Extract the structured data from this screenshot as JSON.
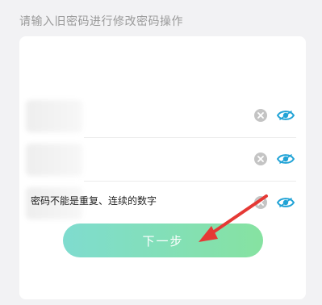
{
  "hint": "请输入旧密码进行修改密码操作",
  "fields": [
    {
      "value": "",
      "placeholder": ""
    },
    {
      "value": "",
      "placeholder": ""
    },
    {
      "value": "",
      "placeholder": ""
    }
  ],
  "icons": {
    "clear": "clear-circle-icon",
    "visibility": "eye-icon"
  },
  "rule_text": "密码不能是重复、连续的数字",
  "next_button": "下一步",
  "colors": {
    "accent": "#21a3d6",
    "button_start": "#7fdccf",
    "button_end": "#86e2a1",
    "annotation_arrow": "#e53935"
  }
}
